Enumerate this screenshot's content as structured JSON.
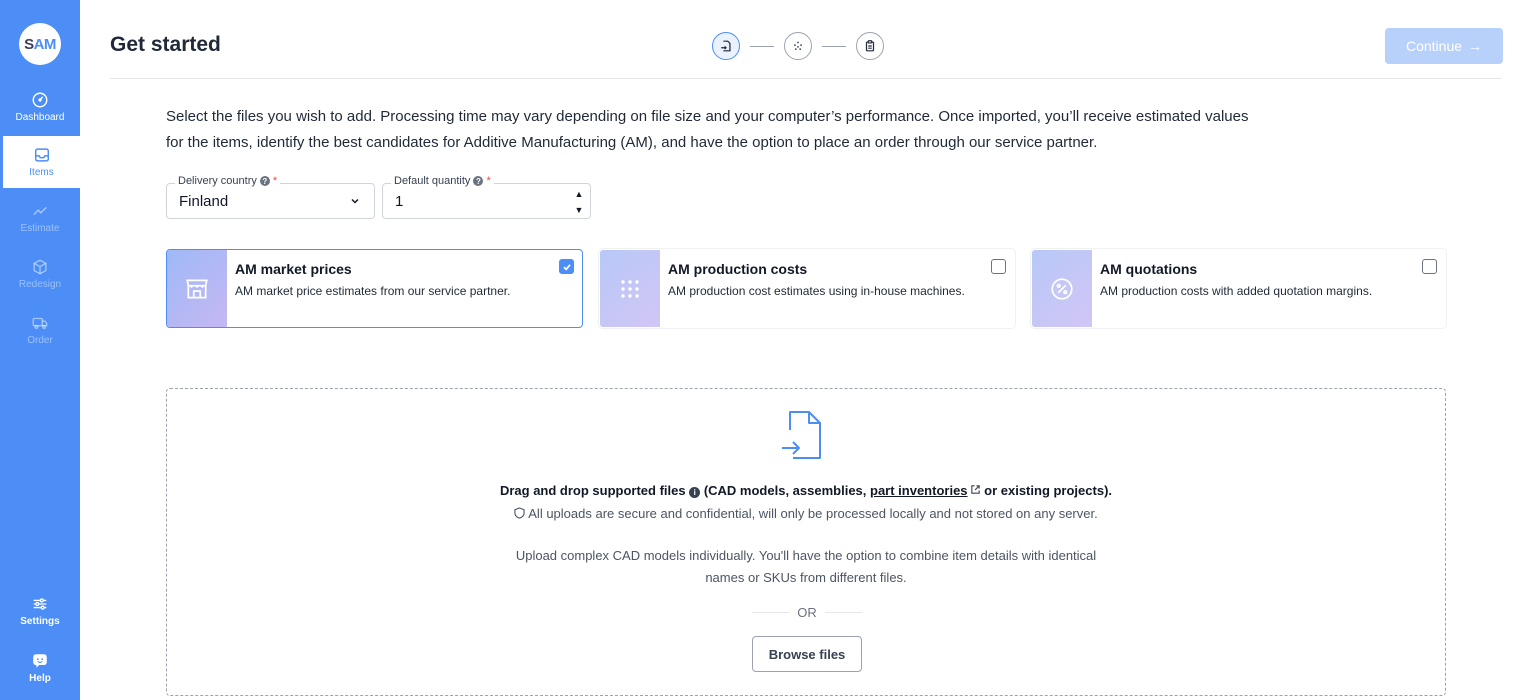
{
  "sidebar": {
    "logo": {
      "s": "S",
      "am": "AM"
    },
    "items": [
      {
        "label": "Dashboard",
        "icon": "gauge-icon",
        "state": "normal"
      },
      {
        "label": "Items",
        "icon": "inbox-icon",
        "state": "active"
      },
      {
        "label": "Estimate",
        "icon": "trend-line-icon",
        "state": "disabled"
      },
      {
        "label": "Redesign",
        "icon": "cube-icon",
        "state": "disabled"
      },
      {
        "label": "Order",
        "icon": "truck-icon",
        "state": "disabled"
      },
      {
        "label": "Settings",
        "icon": "sliders-icon",
        "state": "normal"
      },
      {
        "label": "Help",
        "icon": "chat-bubble-icon",
        "state": "normal"
      }
    ]
  },
  "header": {
    "title": "Get started",
    "continue_label": "Continue",
    "continue_arrow": "→",
    "steps": [
      {
        "icon": "file-import-icon",
        "state": "active"
      },
      {
        "icon": "process-dots-icon",
        "state": "pending"
      },
      {
        "icon": "clipboard-icon",
        "state": "pending"
      }
    ]
  },
  "intro": {
    "line1": "Select the files you wish to add. Processing time may vary depending on file size and your computer’s performance. Once imported, you’ll receive estimated values",
    "line2": "for the items, identify the best candidates for Additive Manufacturing (AM), and have the option to place an order through our service partner."
  },
  "fields": {
    "country": {
      "label": "Delivery country",
      "required": "*",
      "value": "Finland"
    },
    "quantity": {
      "label": "Default quantity",
      "required": "*",
      "value": "1",
      "up": "▲",
      "down": "▼"
    }
  },
  "options": [
    {
      "title": "AM market prices",
      "desc": "AM market price estimates from our service partner.",
      "checked": true,
      "icon": "storefront-icon"
    },
    {
      "title": "AM production costs",
      "desc": "AM production cost estimates using in-house machines.",
      "checked": false,
      "icon": "grid-dots-icon"
    },
    {
      "title": "AM quotations",
      "desc": "AM production costs with added quotation margins.",
      "checked": false,
      "icon": "percent-badge-icon"
    }
  ],
  "dropzone": {
    "main_prefix": "Drag and drop supported files",
    "main_info": "i",
    "main_mid": " (CAD models, assemblies, ",
    "main_link": "part inventories",
    "main_suffix": " or existing projects).",
    "secure": "All uploads are secure and confidential, will only be processed locally and not stored on any server.",
    "complex_line1": "Upload complex CAD models individually. You'll have the option to combine item details with identical",
    "complex_line2": "names or SKUs from different files.",
    "or": "OR",
    "browse": "Browse files"
  },
  "colors": {
    "primary": "#4c8df6",
    "continue_disabled": "#b7d1fb",
    "text": "#1f2937"
  }
}
